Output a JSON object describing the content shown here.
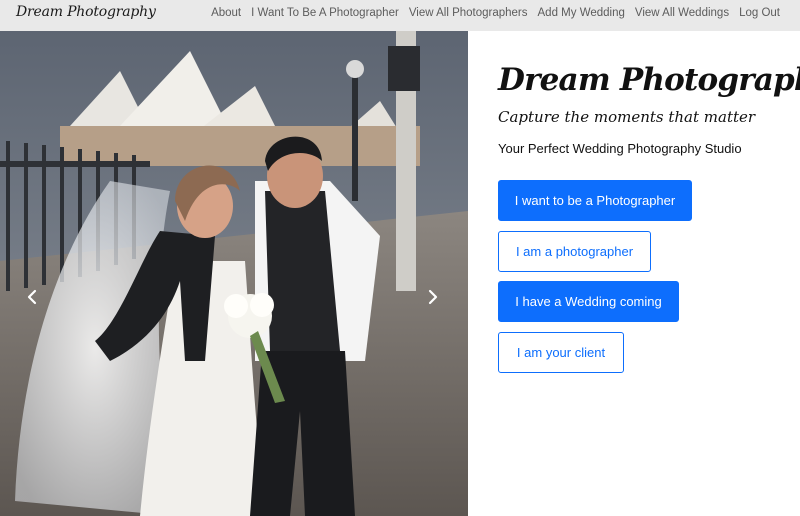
{
  "navbar": {
    "brand": "Dream Photography",
    "links": [
      "About",
      "I Want To Be A Photographer",
      "View All Photographers",
      "Add My Wedding",
      "View All Weddings",
      "Log Out"
    ]
  },
  "hero": {
    "title": "Dream Photography",
    "subtitle": "Capture the moments that matter",
    "tagline": "Your Perfect Wedding Photography Studio"
  },
  "actions": {
    "photographer_signup": "I want to be a Photographer",
    "photographer_login": "I am a photographer",
    "wedding_signup": "I have a Wedding coming",
    "client_login": "I am your client"
  },
  "carousel": {
    "prev_icon": "chevron-left-icon",
    "next_icon": "chevron-right-icon"
  },
  "colors": {
    "primary": "#0d6efd",
    "navbar_bg": "#e9e9e9"
  }
}
